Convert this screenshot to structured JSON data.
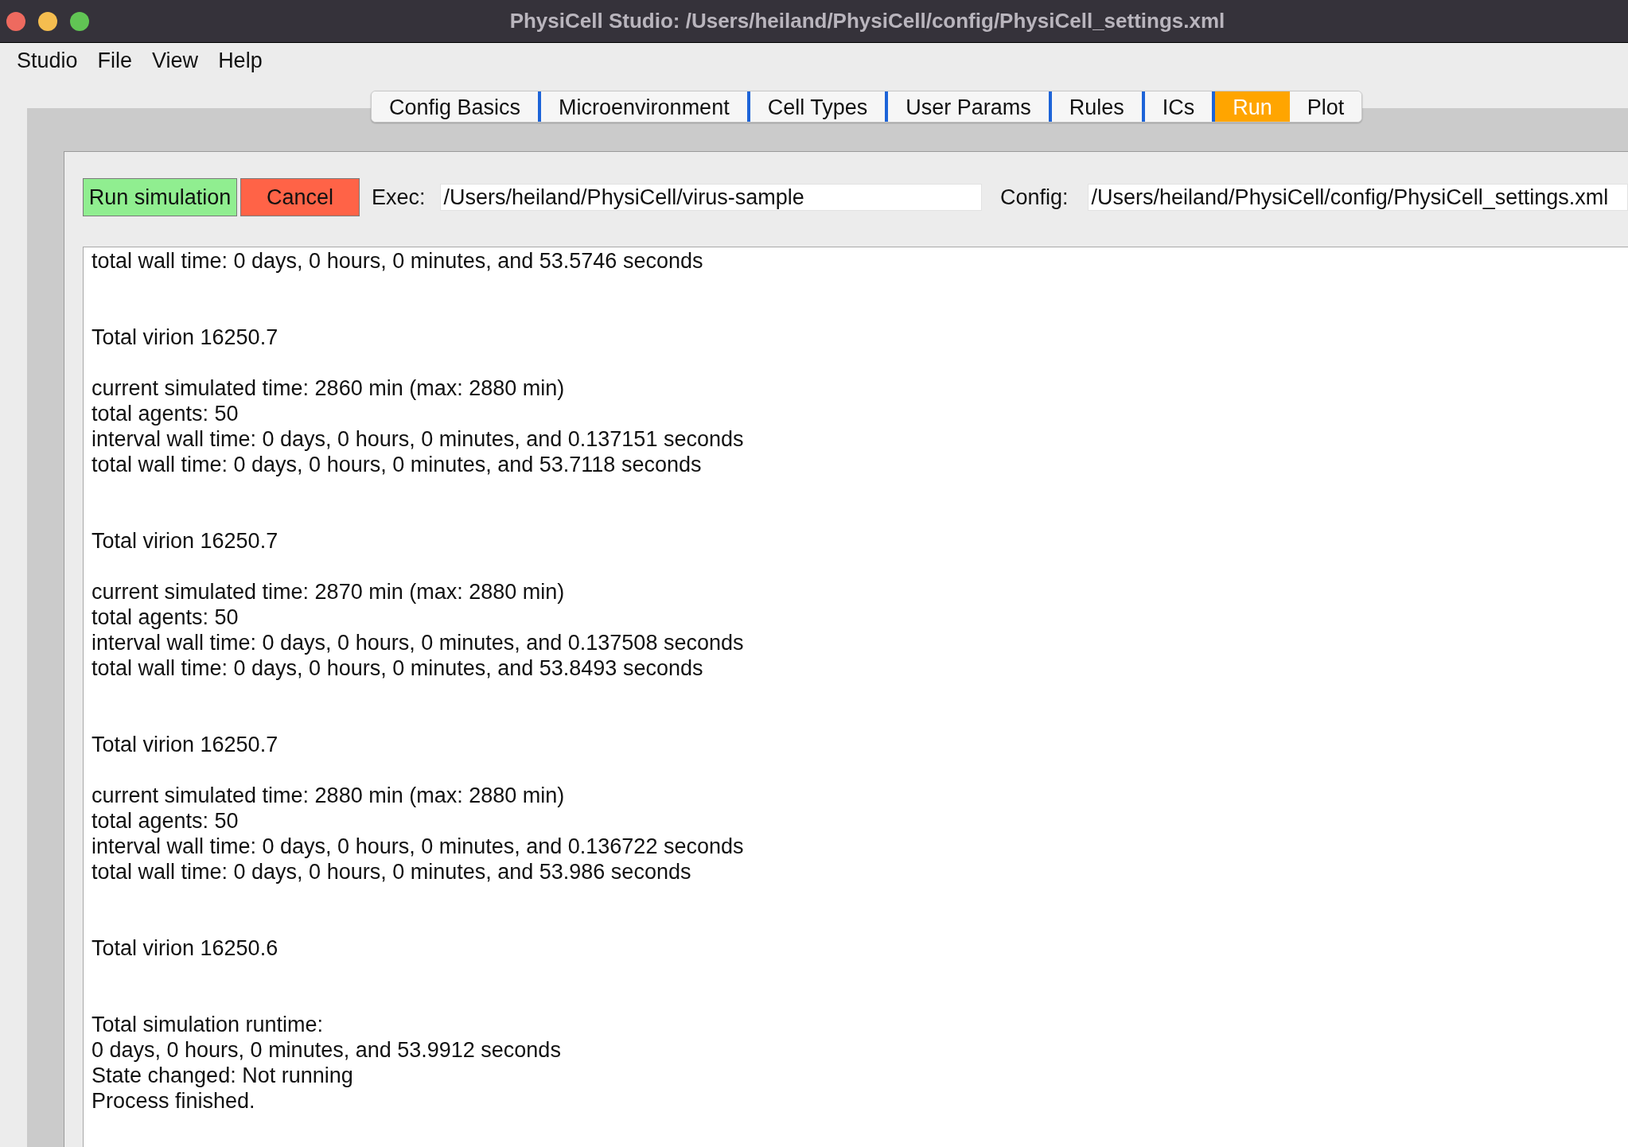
{
  "window": {
    "title": "PhysiCell Studio: /Users/heiland/PhysiCell/config/PhysiCell_settings.xml"
  },
  "menu": [
    "Studio",
    "File",
    "View",
    "Help"
  ],
  "tabs": [
    {
      "label": "Config Basics",
      "selected": false
    },
    {
      "label": "Microenvironment",
      "selected": false
    },
    {
      "label": "Cell Types",
      "selected": false
    },
    {
      "label": "User Params",
      "selected": false
    },
    {
      "label": "Rules",
      "selected": false
    },
    {
      "label": "ICs",
      "selected": false
    },
    {
      "label": "Run",
      "selected": true
    },
    {
      "label": "Plot",
      "selected": false
    }
  ],
  "run_panel": {
    "buttons": [
      {
        "label": "Run simulation",
        "kind": "run"
      },
      {
        "label": "Cancel",
        "kind": "cancel"
      }
    ],
    "exec": {
      "label": "Exec:",
      "value": "/Users/heiland/PhysiCell/virus-sample"
    },
    "config": {
      "label": "Config:",
      "value": "/Users/heiland/PhysiCell/config/PhysiCell_settings.xml"
    },
    "log": [
      {
        "kind": "line",
        "text": "total wall time: 0 days, 0 hours, 0 minutes, and 53.5746 seconds"
      },
      {
        "kind": "blank"
      },
      {
        "kind": "blank"
      },
      {
        "kind": "line",
        "text": "Total virion 16250.7"
      },
      {
        "kind": "blank"
      },
      {
        "kind": "line",
        "text": "current simulated time: 2860 min (max: 2880 min)"
      },
      {
        "kind": "line",
        "text": "total agents: 50"
      },
      {
        "kind": "line",
        "text": "interval wall time: 0 days, 0 hours, 0 minutes, and 0.137151 seconds"
      },
      {
        "kind": "line",
        "text": "total wall time: 0 days, 0 hours, 0 minutes, and 53.7118 seconds"
      },
      {
        "kind": "blank"
      },
      {
        "kind": "blank"
      },
      {
        "kind": "line",
        "text": "Total virion 16250.7"
      },
      {
        "kind": "blank"
      },
      {
        "kind": "line",
        "text": "current simulated time: 2870 min (max: 2880 min)"
      },
      {
        "kind": "line",
        "text": "total agents: 50"
      },
      {
        "kind": "line",
        "text": "interval wall time: 0 days, 0 hours, 0 minutes, and 0.137508 seconds"
      },
      {
        "kind": "line",
        "text": "total wall time: 0 days, 0 hours, 0 minutes, and 53.8493 seconds"
      },
      {
        "kind": "blank"
      },
      {
        "kind": "blank"
      },
      {
        "kind": "line",
        "text": "Total virion 16250.7"
      },
      {
        "kind": "blank"
      },
      {
        "kind": "line",
        "text": "current simulated time: 2880 min (max: 2880 min)"
      },
      {
        "kind": "line",
        "text": "total agents: 50"
      },
      {
        "kind": "line",
        "text": "interval wall time: 0 days, 0 hours, 0 minutes, and 0.136722 seconds"
      },
      {
        "kind": "line",
        "text": "total wall time: 0 days, 0 hours, 0 minutes, and 53.986 seconds"
      },
      {
        "kind": "blank"
      },
      {
        "kind": "blank"
      },
      {
        "kind": "line",
        "text": "Total virion 16250.6"
      },
      {
        "kind": "blank"
      },
      {
        "kind": "blank"
      },
      {
        "kind": "line",
        "text": "Total simulation runtime:"
      },
      {
        "kind": "line",
        "text": "0 days, 0 hours, 0 minutes, and 53.9912 seconds"
      },
      {
        "kind": "line",
        "text": "State changed: Not running"
      },
      {
        "kind": "line",
        "text": "Process finished."
      }
    ]
  }
}
